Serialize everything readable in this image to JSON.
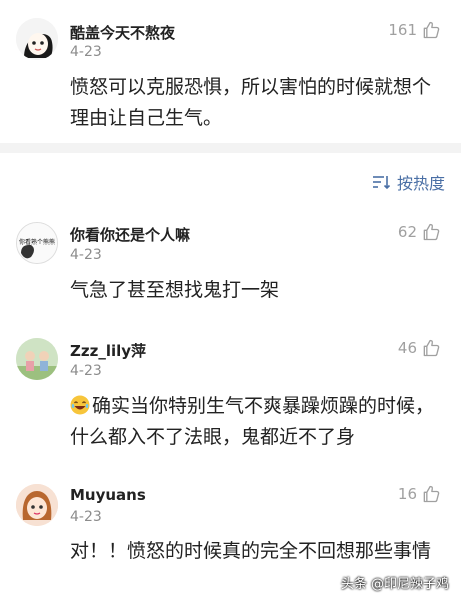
{
  "top_comment": {
    "username": "酷盖今天不熬夜",
    "date": "4-23",
    "likes": "161",
    "text": "愤怒可以克服恐惧，所以害怕的时候就想个理由让自己生气。"
  },
  "sort": {
    "label": "按热度"
  },
  "comments": [
    {
      "username": "你看你还是个人嘛",
      "date": "4-23",
      "likes": "62",
      "text": "气急了甚至想找鬼打一架",
      "avatar_text": "你看熟个熊熊"
    },
    {
      "username": "Zzz_lily萍",
      "date": "4-23",
      "likes": "46",
      "text": "确实当你特别生气不爽暴躁烦躁的时候，什么都入不了法眼，鬼都近不了身"
    },
    {
      "username": "Muyuans",
      "date": "4-23",
      "likes": "16",
      "text": "对！！愤怒的时候真的完全不回想那些事情"
    }
  ],
  "watermark": "头条 @印尼辣子鸡",
  "colors": {
    "sort_accent": "#4a6fa5",
    "muted": "#8c8c8c",
    "divider": "#f3f3f3"
  }
}
